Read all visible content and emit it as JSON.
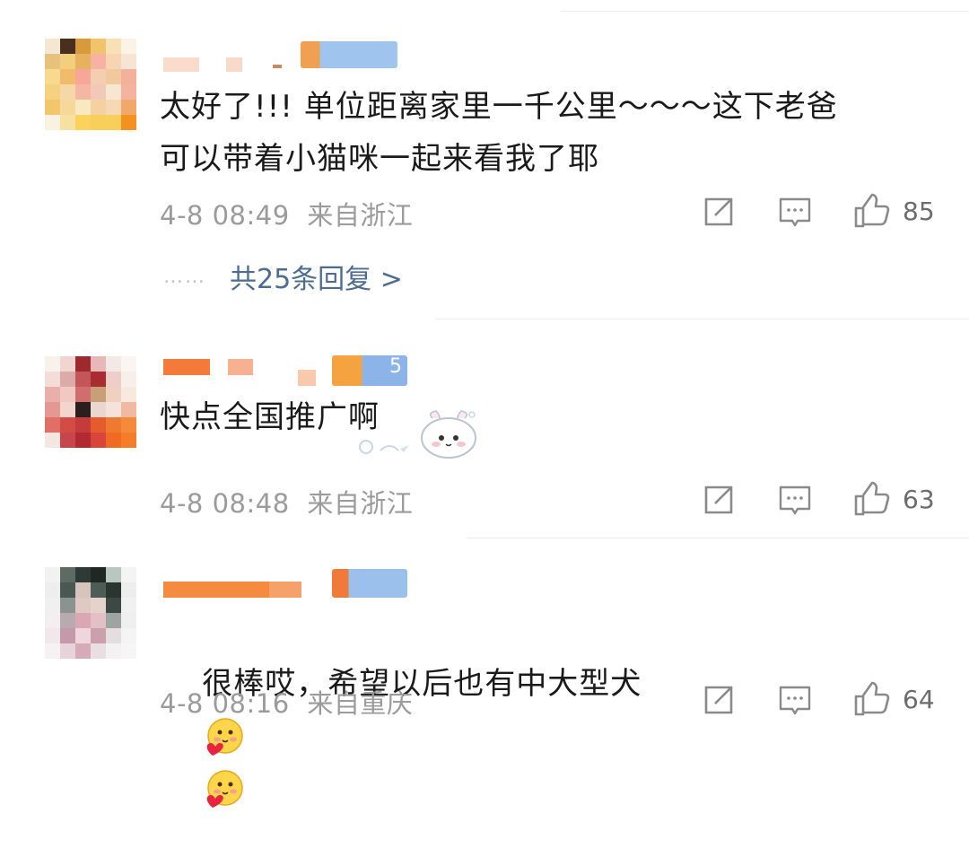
{
  "comments": [
    {
      "text": "太好了!!! 单位距离家里一千公里～～～这下老爸\n可以带着小猫咪一起来看我了耶",
      "date": "4-8 08:49",
      "location": "来自浙江",
      "likes": "85",
      "reply_dots": "……",
      "reply_link": "共25条回复 >"
    },
    {
      "text": "快点全国推广啊",
      "date": "4-8 08:48",
      "location": "来自浙江",
      "likes": "63",
      "badge_num": "5",
      "sticker": "cute-bun-sticker"
    },
    {
      "text": "很棒哎，希望以后也有中大型犬",
      "date": "4-8 08:16",
      "location": "来自重庆",
      "likes": "64",
      "emojis": [
        "heart-hug-emoji",
        "heart-hug-emoji"
      ]
    }
  ],
  "colors": {
    "link": "#4c6c93",
    "meta": "#9b9b9b",
    "icon": "#8a8a8a"
  },
  "icons": [
    "share-icon",
    "comment-icon",
    "like-icon"
  ]
}
